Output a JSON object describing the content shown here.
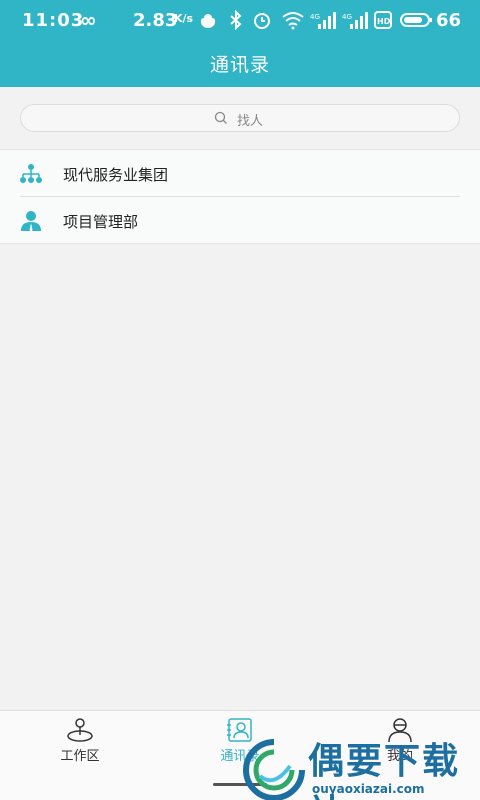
{
  "status_bar": {
    "time": "11:03",
    "infinity": "∞",
    "speed": "2.83",
    "speed_unit": "K/s",
    "battery": "66"
  },
  "header": {
    "title": "通讯录"
  },
  "search": {
    "placeholder": "找人"
  },
  "list": {
    "items": [
      {
        "label": "现代服务业集团",
        "icon": "org-chart-icon"
      },
      {
        "label": "项目管理部",
        "icon": "person-icon"
      }
    ]
  },
  "bottom_nav": {
    "items": [
      {
        "label": "工作区",
        "icon": "workspace-icon",
        "active": false
      },
      {
        "label": "通讯录",
        "icon": "contacts-icon",
        "active": true
      },
      {
        "label": "我的",
        "icon": "profile-icon",
        "active": false
      }
    ]
  },
  "watermark": {
    "title": "偶要下载站",
    "url": "ouyaoxiazai.com"
  },
  "colors": {
    "accent": "#2fb5c6",
    "background": "#f2f2f2",
    "watermark_blue": "#1c6fa0"
  }
}
